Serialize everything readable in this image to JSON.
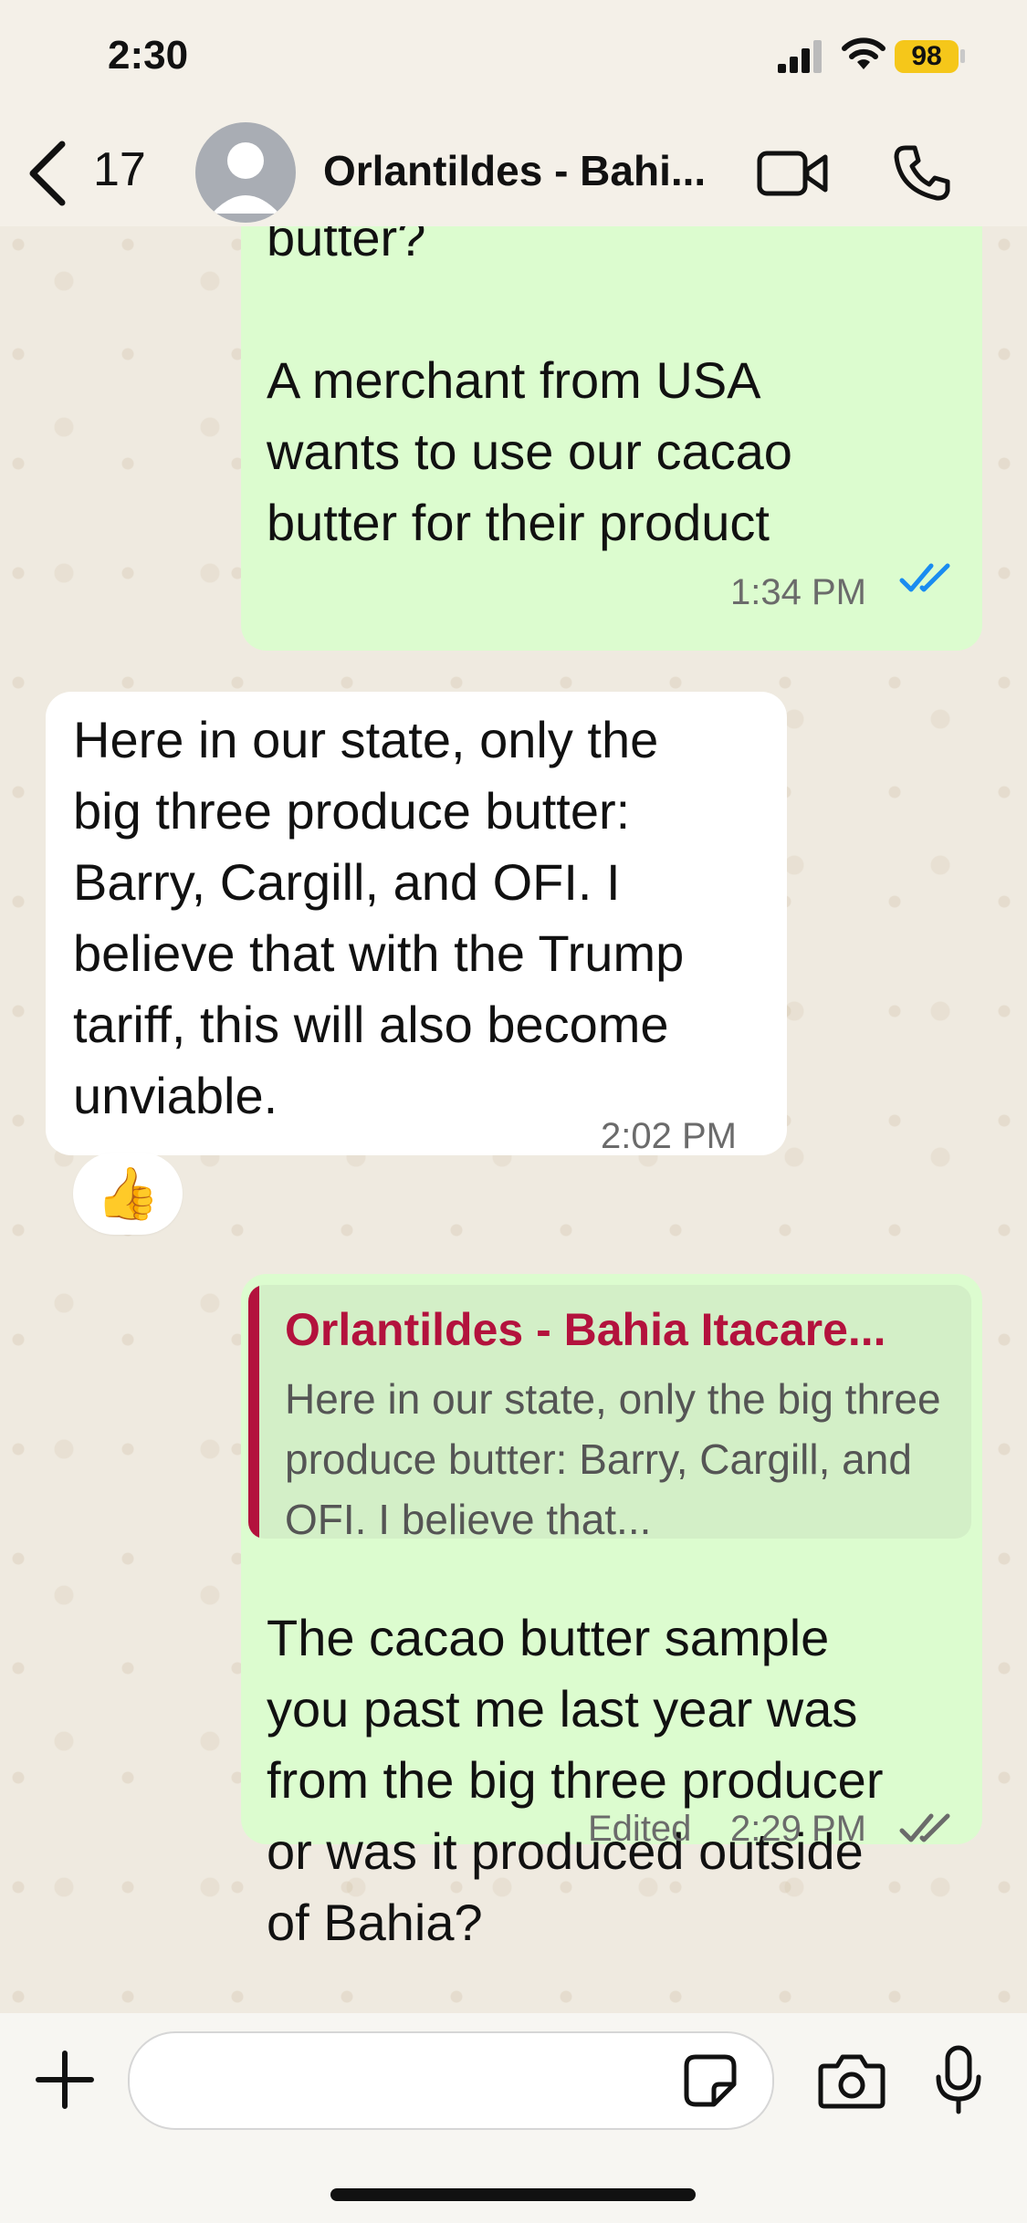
{
  "status_bar": {
    "time": "2:30",
    "battery": "98",
    "battery_color": "#f5c71a"
  },
  "header": {
    "back_count": "17",
    "chat_name": "Orlantildes - Bahi..."
  },
  "messages": [
    {
      "direction": "outgoing",
      "text": "butter?\n\nA merchant from USA\nwants to use our cacao\nbutter for their product",
      "time": "1:34 PM",
      "status": "read"
    },
    {
      "direction": "incoming",
      "text": "Here in our state, only the\nbig three produce butter:\nBarry, Cargill, and OFI. I\nbelieve that with the Trump\ntariff, this will also become\nunviable.",
      "time": "2:02 PM",
      "reaction": "👍"
    },
    {
      "direction": "outgoing",
      "quote": {
        "author": "Orlantildes - Bahia Itacare...",
        "text": "Here in our state, only the big three produce butter: Barry, Cargill, and OFI. I believe that..."
      },
      "text": "The cacao butter sample\nyou past me last year was\nfrom the big three producer\nor was it produced outside\nof Bahia?",
      "edited_label": "Edited",
      "time": "2:29 PM",
      "status": "delivered"
    }
  ],
  "colors": {
    "outgoing_bubble": "#dcfccf",
    "incoming_bubble": "#ffffff",
    "quote_accent": "#b3123d",
    "read_ticks": "#1a8cf0"
  },
  "input": {
    "placeholder": ""
  }
}
